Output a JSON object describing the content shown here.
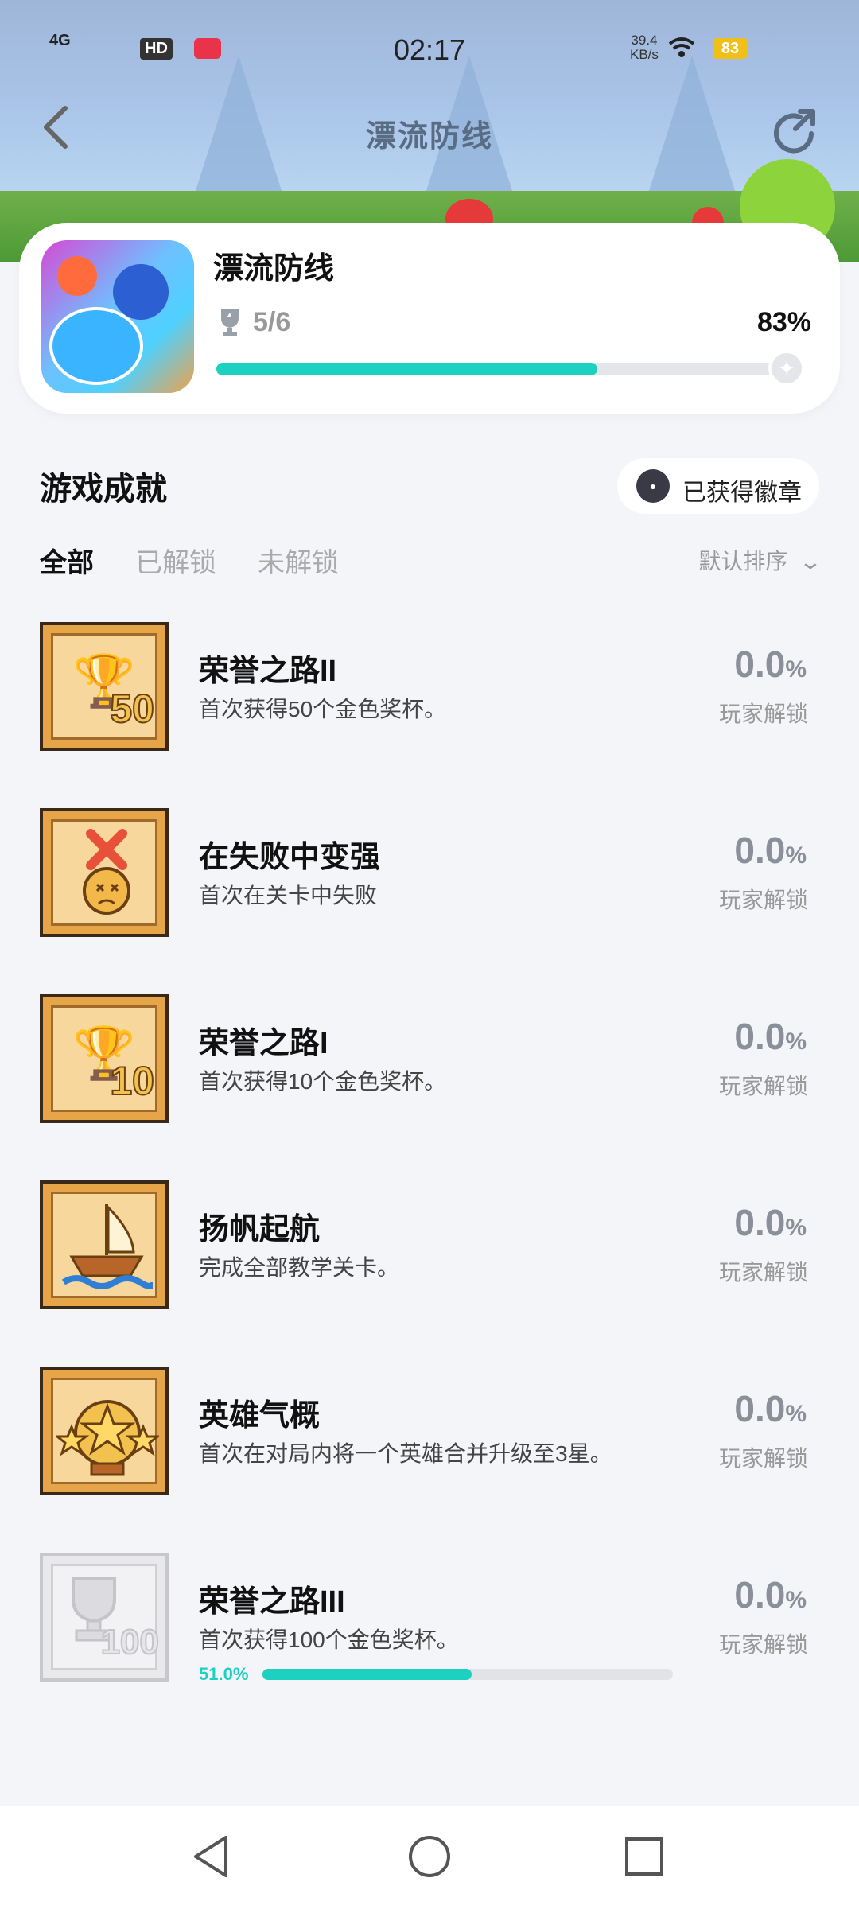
{
  "status_bar": {
    "network": "4G",
    "hd": "HD",
    "time": "02:17",
    "speed": "39.4\nKB/s",
    "battery": "83"
  },
  "header": {
    "title": "漂流防线",
    "back_icon": "back-arrow-icon",
    "share_icon": "share-icon"
  },
  "game": {
    "name": "漂流防线",
    "achievements_count": "5/6",
    "percent_label": "83%",
    "progress_fraction": 0.83
  },
  "section": {
    "title": "游戏成就",
    "badge_button_label": "已获得徽章"
  },
  "tabs": [
    {
      "label": "全部",
      "active": true
    },
    {
      "label": "已解锁",
      "active": false
    },
    {
      "label": "未解锁",
      "active": false
    }
  ],
  "sort_label": "默认排序",
  "achievements": [
    {
      "title": "荣誉之路II",
      "desc": "首次获得50个金色奖杯。",
      "rate": "0.0",
      "rate_unit": "%",
      "rate_label": "玩家解锁",
      "icon": "trophy-50-icon",
      "badge_num": "50",
      "locked": false
    },
    {
      "title": "在失败中变强",
      "desc": "首次在关卡中失败",
      "rate": "0.0",
      "rate_unit": "%",
      "rate_label": "玩家解锁",
      "icon": "dizzy-face-icon",
      "badge_num": "",
      "locked": false
    },
    {
      "title": "荣誉之路I",
      "desc": "首次获得10个金色奖杯。",
      "rate": "0.0",
      "rate_unit": "%",
      "rate_label": "玩家解锁",
      "icon": "trophy-10-icon",
      "badge_num": "10",
      "locked": false
    },
    {
      "title": "扬帆起航",
      "desc": "完成全部教学关卡。",
      "rate": "0.0",
      "rate_unit": "%",
      "rate_label": "玩家解锁",
      "icon": "sailboat-icon",
      "badge_num": "",
      "locked": false
    },
    {
      "title": "英雄气概",
      "desc": "首次在对局内将一个英雄合并升级至3星。",
      "rate": "0.0",
      "rate_unit": "%",
      "rate_label": "玩家解锁",
      "icon": "three-stars-icon",
      "badge_num": "",
      "locked": false
    },
    {
      "title": "荣誉之路III",
      "desc": "首次获得100个金色奖杯。",
      "rate": "0.0",
      "rate_unit": "%",
      "rate_label": "玩家解锁",
      "icon": "trophy-100-icon",
      "badge_num": "100",
      "locked": true,
      "progress_label": "51.0%",
      "progress_fraction": 0.51
    }
  ],
  "colors": {
    "accent": "#1dd1c1",
    "badge_gold": "#e7a54a",
    "locked_grey": "#e9e9ec"
  }
}
